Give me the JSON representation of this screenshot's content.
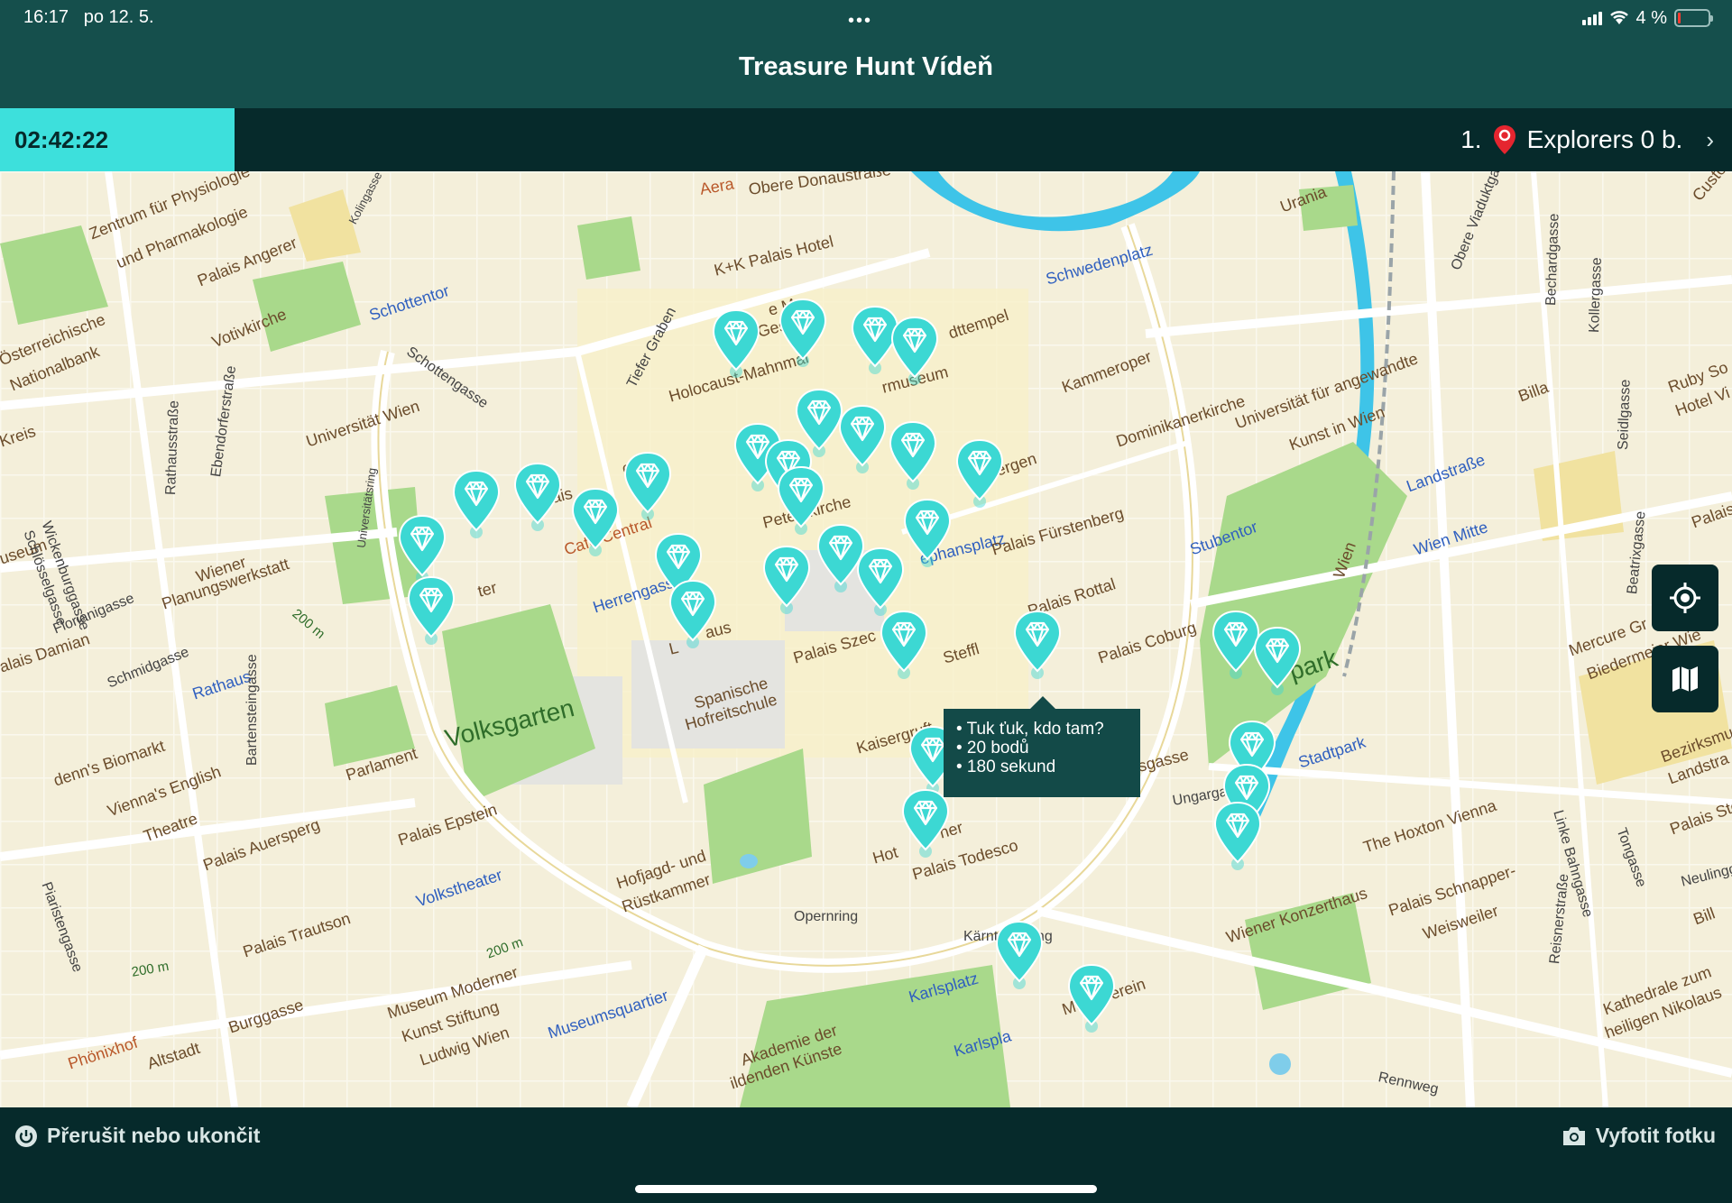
{
  "status_bar": {
    "time": "16:17",
    "date": "po 12. 5.",
    "dots": "•••",
    "battery": "4 %"
  },
  "app": {
    "title": "Treasure Hunt Vídeň"
  },
  "team_bar": {
    "timer": "02:42:22",
    "rank": "1.",
    "team": "Explorers 0 b.",
    "chevron": "›"
  },
  "tooltip": {
    "line1": "• Tuk ťuk, kdo tam?",
    "line2": "• 20 bodů",
    "line3": "• 180 sekund"
  },
  "map_labels": {
    "donaustrasse": "Obere Donaustraße",
    "aera": "Aera",
    "palais_hotel": "K+K Palais Hotel",
    "schottentor": "Schottentor",
    "schwedenplatz": "Schwedenplatz",
    "urania": "Urania",
    "zentrum": "Zentrum für Physiologie",
    "pharmakologie": "und Pharmakologie",
    "palais_angerer": "Palais Angerer",
    "votivkirche": "Votivkirche",
    "nationalbank1": "Österreichische",
    "nationalbank2": "Nationalbank",
    "schottengasse": "Schottengasse",
    "tiefer_graben": "Tiefer Graben",
    "holocaust": "Holocaust-Mahnmal",
    "ermuseum": "rmuseum",
    "stadttempel": "dttempel",
    "kammeroper": "Kammeroper",
    "universitaet_wien": "Universität Wien",
    "cafe_central": "Café Central",
    "peterskirche": "Peterskirche",
    "stephansplatz": "ephansplatz",
    "pergen": "s Pergen",
    "dominikanerkirche": "Dominikanerkirche",
    "angewandte1": "Universität für angewandte",
    "angewandte2": "Kunst in Wien",
    "landstrasse": "Landstraße",
    "herrengasse": "Herrengasse",
    "palais_fuerstenberg": "Palais Fürstenberg",
    "stubentor": "Stubentor",
    "wien_mitte": "Wien Mitte",
    "palais_rottal": "Palais Rottal",
    "palais_coburg": "Palais Coburg",
    "stadtpark": "Stadtpark",
    "stadtpark_park": "park",
    "wiener_planung1": "Wiener",
    "wiener_planung2": "Planungswerkstatt",
    "rathaus": "Rathaus",
    "volksgarten": "Volksgarten",
    "parlament": "Parlament",
    "spanische1": "Spanische",
    "spanische2": "Hofreitschule",
    "palais_szec": "Palais Szec",
    "steffl": "Steffl",
    "kaisergruft": "Kaisergruft",
    "biomarkt": "denn's Biomarkt",
    "english_theatre1": "Vienna's English",
    "english_theatre2": "Theatre",
    "palais_auersperg": "Palais Auersperg",
    "palais_epstein": "Palais Epstein",
    "volkstheater": "Volkstheater",
    "hofjagd1": "Hofjagd- und",
    "hofjagd2": "Rüstkammer",
    "opernring": "Opernring",
    "kaerntner_ring": "Kärntner Ring",
    "palais_todesco": "Palais Todesco",
    "wiener_konzerthaus": "Wiener Konzerthaus",
    "hoxton": "The Hoxton Vienna",
    "schnapper1": "Palais Schnapper-",
    "schnapper2": "Weisweiler",
    "palais_trautson": "Palais Trautson",
    "museum_moderner1": "Museum Moderner",
    "museum_moderner2": "Kunst Stiftung",
    "museum_moderner3": "Ludwig Wien",
    "museumsquartier": "Museumsquartier",
    "karlsplatz": "Karlsplatz",
    "karlspl": "Karlspla",
    "musikverein": "Musikverein",
    "akademie1": "Akademie der",
    "akademie2": "ildenden Künste",
    "burggasse": "Burggasse",
    "altstadt": "Altstadt",
    "phoenixhof": "Phönixhof",
    "rennweg": "Rennweg",
    "billa": "Billa",
    "ruby1": "Ruby So",
    "ruby2": "Hotel Vi",
    "mercure1": "Mercure Gr",
    "mercure2": "Biedermeier Wie",
    "bezirksmuseum1": "Bezirksmuse",
    "bezirksmuseum2": "Landstra",
    "kathedrale1": "Kathedrale zum",
    "kathedrale2": "heiligen Nikolaus",
    "palais_damian": "alais Damian",
    "museum_left": "useum",
    "kreis": "Kreis",
    "wien_river": "Wien",
    "gasse": "sgasse",
    "hot": "Hot",
    "ner": "ner",
    "ch": "ch",
    "gesl": "Ges",
    "ais": "ais",
    "le_m": "e M",
    "la": "L",
    "aus": "aus",
    "bu": "Bu",
    "ter": "ter",
    "m200a": "200 m",
    "m200b": "200 m",
    "m200c": "200 m",
    "ugasse": "Ungargasse"
  },
  "streets": {
    "wickenburggasse": "Wickenburggasse",
    "schloesselgasse": "Schlösselgasse",
    "floriani": "Florianigasse",
    "schmidgasse": "Schmidgasse",
    "rathausstrasse": "Rathausstraße",
    "ebendorfer": "Ebendorferstraße",
    "universitaetsring": "Universitätsring",
    "bartenstein": "Bartensteingasse",
    "piaristen": "Piaristengasse",
    "kolingasse": "Kolingasse",
    "obere_viadukt": "Obere Viaduktgasse",
    "bechard": "Bechardgasse",
    "koller": "Kollergasse",
    "seidl": "Seidlgasse",
    "beatrix": "Beatrixgasse",
    "linke_bahn": "Linke Bahngasse",
    "tongasse": "Tongasse",
    "reisner": "Reisnerstraße",
    "neulinggasse": "Neulinggasse",
    "palais_ste": "Palais Ste",
    "bill": "Bill",
    "palais_right": "Palais",
    "custo": "Custo"
  },
  "controls": {
    "locate": "locate-icon",
    "map_layers": "map-icon"
  },
  "bottom_bar": {
    "interrupt": "Přerušit nebo ukončit",
    "photo": "Vyfotit fotku"
  },
  "colors": {
    "header": "#154f4c",
    "bar": "#062a2b",
    "accent": "#3de0dc",
    "pin": "#3cd8d3"
  }
}
